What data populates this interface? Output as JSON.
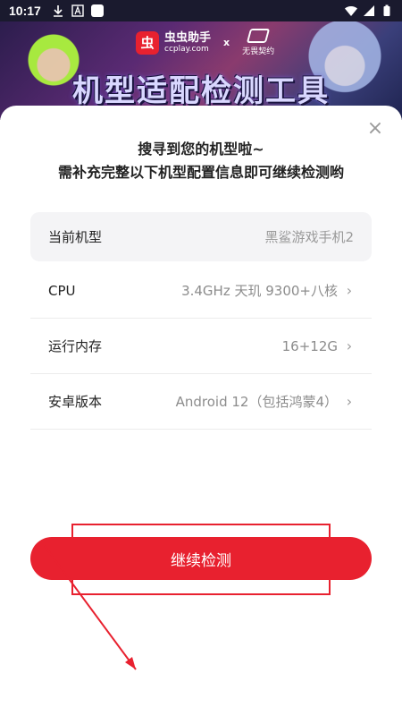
{
  "status_bar": {
    "time": "10:17",
    "left_icons": [
      "download-icon",
      "font-icon",
      "app-icon"
    ],
    "right_icons": [
      "wifi-icon",
      "signal-icon",
      "battery-icon"
    ]
  },
  "banner": {
    "brand_name": "虫虫助手",
    "brand_site": "ccplay.com",
    "brand_badge": "虫",
    "x_sep": "x",
    "partner_name": "无畏契约",
    "title": "机型适配检测工具"
  },
  "sheet": {
    "heading_line1": "搜寻到您的机型啦~",
    "heading_line2": "需补充完整以下机型配置信息即可继续检测哟",
    "close_glyph": "×",
    "chevron_glyph": "›",
    "rows": [
      {
        "label": "当前机型",
        "value": "黑鲨游戏手机2"
      },
      {
        "label": "CPU",
        "value": "3.4GHz 天玑 9300+八核"
      },
      {
        "label": "运行内存",
        "value": "16+12G"
      },
      {
        "label": "安卓版本",
        "value": "Android 12（包括鸿蒙4）"
      }
    ],
    "cta_label": "继续检测"
  },
  "colors": {
    "accent": "#e8212f",
    "text": "#222222",
    "muted": "#8c8c8c",
    "row_bg": "#f4f4f6"
  }
}
